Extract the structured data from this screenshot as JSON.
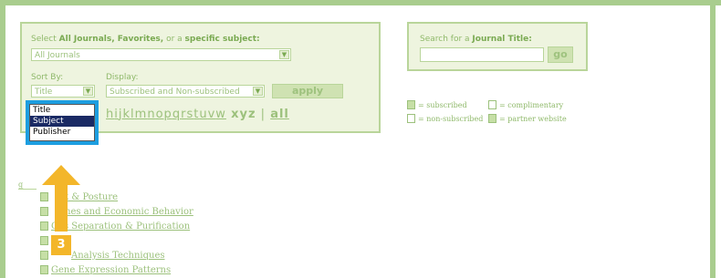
{
  "filter": {
    "select_prefix": "Select ",
    "select_bold1": "All Journals, Favorites,",
    "select_mid": " or a ",
    "select_bold2": "specific subject:",
    "journal_select_value": "All Journals",
    "sort_by_label": "Sort By:",
    "display_label": "Display:",
    "sort_value": "Title",
    "display_value": "Subscribed and Non-subscribed",
    "apply_label": "apply"
  },
  "alphabet": {
    "underlined": [
      "h",
      "i",
      "j",
      "k",
      "l",
      "m",
      "n",
      "o",
      "p",
      "q",
      "r",
      "s",
      "t",
      "u",
      "v",
      "w"
    ],
    "plain": [
      "x",
      "y",
      "z"
    ],
    "separator": "|",
    "all_label": "all"
  },
  "search": {
    "label_prefix": "Search for a ",
    "label_bold": "Journal Title:",
    "input_value": "",
    "go_label": "go"
  },
  "sort_dropdown": {
    "options": [
      "Title",
      "Subject",
      "Publisher"
    ],
    "selected": "Subject"
  },
  "legend": {
    "subscribed": "= subscribed",
    "complimentary": "= complimentary",
    "non_subscribed": "= non-subscribed",
    "partner": "= partner website"
  },
  "list": {
    "group_letter": "g",
    "items": [
      "Gait & Posture",
      "Games and Economic Behavior",
      "Gas Separation & Purification",
      "",
      "Gene Analysis Techniques",
      "Gene Expression Patterns"
    ],
    "item_visible_text": [
      "ait & Posture",
      "ames and Economic Behavior",
      "Gas Separation & Purification",
      "",
      "Analysis Techniques",
      "Gene Expression Patterns"
    ]
  },
  "callout": {
    "step_number": "3",
    "highlight_color": "#1d9ee0",
    "arrow_color": "#f3b62a"
  },
  "colors": {
    "frame": "#a9cd8e",
    "panel_bg": "#eef4df",
    "text_green": "#9cc17c"
  }
}
